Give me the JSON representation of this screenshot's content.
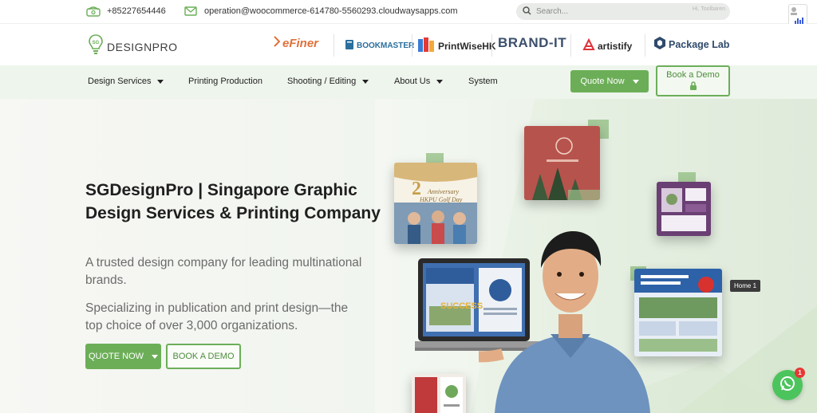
{
  "topbar": {
    "phone": "+85227654446",
    "email": "operation@woocommerce-614780-5560293.cloudwaysapps.com",
    "search_placeholder": "Search...",
    "search_user": "Hi, Toolbaren"
  },
  "brand": {
    "logo_text": "DESIGNPRO",
    "logo_mark": "SG",
    "partners": [
      "eFiner",
      "BOOKMASTER",
      "PrintWiseHK",
      "BRAND-IT",
      "artistify",
      "Package Lab"
    ]
  },
  "nav": {
    "items": [
      {
        "label": "Design Services",
        "dropdown": true
      },
      {
        "label": "Printing Production",
        "dropdown": false
      },
      {
        "label": "Shooting / Editing",
        "dropdown": true
      },
      {
        "label": "About Us",
        "dropdown": true
      },
      {
        "label": "System",
        "dropdown": false
      }
    ],
    "quote_label": "Quote Now",
    "demo_label": "Book a Demo"
  },
  "hero": {
    "title": "SGDesignPro | Singapore Graphic Design Services & Printing Company",
    "subtitle1": "A trusted design company for leading multinational brands.",
    "subtitle2": "Specializing in publication and print design—the top choice of over 3,000 organizations.",
    "quote_button": "QUOTE NOW",
    "demo_button": "BOOK A DEMO",
    "card_text_1": "Anniversary",
    "card_text_2": "HKPU Golf Day",
    "laptop_text": "SUCCESS"
  },
  "home_tag": "Home 1",
  "whatsapp_badge": "1",
  "colors": {
    "accent": "#6cae58",
    "nav_bg": "#eef5ec",
    "whatsapp": "#4cc45d"
  }
}
